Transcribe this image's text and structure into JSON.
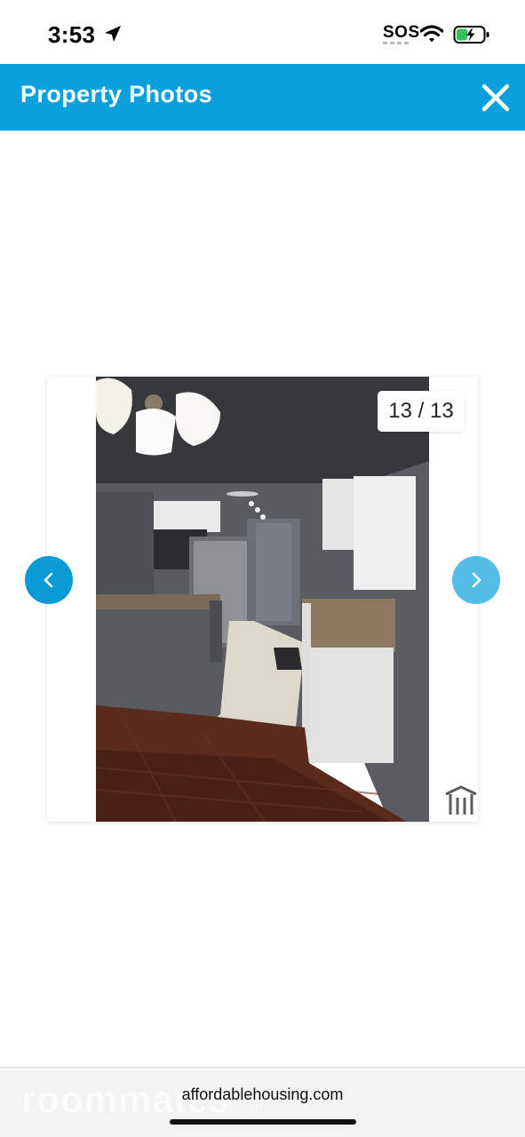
{
  "status_bar": {
    "time": "3:53",
    "sos": "SOS",
    "icons": [
      "location-arrow-icon",
      "wifi-icon",
      "battery-charging-icon"
    ]
  },
  "header": {
    "title": "Property Photos",
    "close_icon": "close-icon",
    "background_color": "#0aa0dc"
  },
  "gallery": {
    "counter": "13 / 13",
    "current_index": 13,
    "total": 13,
    "prev_icon": "chevron-left-icon",
    "next_icon": "chevron-right-icon",
    "photo_subject": "kitchen",
    "watermark_icon": "house-outline-icon"
  },
  "browser": {
    "domain": "affordablehousing.com",
    "watermark_text": "roommates",
    "watermark_suffix": ".com"
  }
}
